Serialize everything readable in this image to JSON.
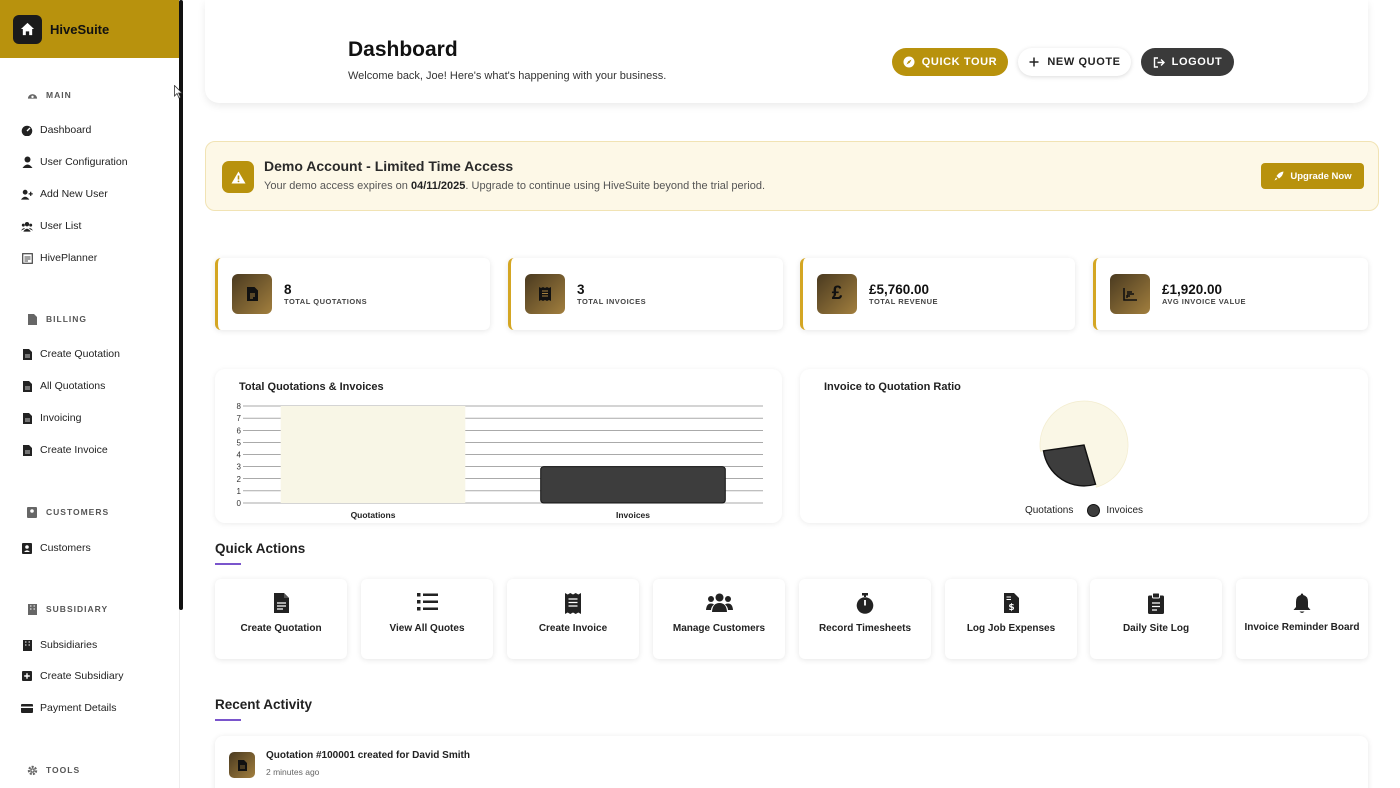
{
  "brand": {
    "name": "HiveSuite"
  },
  "sidebar": {
    "sections": {
      "main": "MAIN",
      "billing": "BILLING",
      "customers": "CUSTOMERS",
      "subsidiary": "SUBSIDIARY",
      "tools": "TOOLS"
    },
    "items": [
      {
        "label": "Dashboard",
        "icon": "gauge-icon"
      },
      {
        "label": "User Configuration",
        "icon": "user-icon"
      },
      {
        "label": "Add New User",
        "icon": "user-plus-icon"
      },
      {
        "label": "User List",
        "icon": "users-icon"
      },
      {
        "label": "HivePlanner",
        "icon": "planner-icon"
      },
      {
        "label": "Create Quotation",
        "icon": "file-icon"
      },
      {
        "label": "All Quotations",
        "icon": "file-icon"
      },
      {
        "label": "Invoicing",
        "icon": "file-icon"
      },
      {
        "label": "Create Invoice",
        "icon": "file-icon"
      },
      {
        "label": "Customers",
        "icon": "contact-icon"
      },
      {
        "label": "Subsidiaries",
        "icon": "building-icon"
      },
      {
        "label": "Create Subsidiary",
        "icon": "plus-square-icon"
      },
      {
        "label": "Payment Details",
        "icon": "card-icon"
      }
    ]
  },
  "header": {
    "title": "Dashboard",
    "subtitle": "Welcome back, Joe! Here's what's happening with your business.",
    "quick_tour": "QUICK TOUR",
    "new_quote": "NEW QUOTE",
    "logout": "LOGOUT"
  },
  "banner": {
    "title": "Demo Account - Limited Time Access",
    "text_before": "Your demo access expires on ",
    "date": "04/11/2025",
    "text_after": ". Upgrade to continue using HiveSuite beyond the trial period.",
    "upgrade": "Upgrade Now"
  },
  "stats": [
    {
      "value": "8",
      "label": "TOTAL QUOTATIONS"
    },
    {
      "value": "3",
      "label": "TOTAL INVOICES"
    },
    {
      "value": "£5,760.00",
      "label": "TOTAL REVENUE"
    },
    {
      "value": "£1,920.00",
      "label": "AVG INVOICE VALUE"
    }
  ],
  "charts": {
    "bar_title": "Total Quotations & Invoices",
    "pie_title": "Invoice to Quotation Ratio",
    "legend_quotations": "Quotations",
    "legend_invoices": "Invoices"
  },
  "chart_data": [
    {
      "type": "bar",
      "title": "Total Quotations & Invoices",
      "categories": [
        "Quotations",
        "Invoices"
      ],
      "values": [
        8,
        3
      ],
      "ylim": [
        0,
        8
      ],
      "yticks": [
        0,
        1,
        2,
        3,
        4,
        5,
        6,
        7,
        8
      ],
      "colors": [
        "#f8f6e6",
        "#3d3d3d"
      ]
    },
    {
      "type": "pie",
      "title": "Invoice to Quotation Ratio",
      "labels": [
        "Quotations",
        "Invoices"
      ],
      "values": [
        8,
        3
      ],
      "colors": [
        "#faf7e6",
        "#3d3d3d"
      ],
      "legend": "bottom"
    }
  ],
  "quick_actions": {
    "title": "Quick Actions",
    "items": [
      {
        "label": "Create Quotation",
        "icon": "file-icon"
      },
      {
        "label": "View All Quotes",
        "icon": "list-icon"
      },
      {
        "label": "Create Invoice",
        "icon": "receipt-icon"
      },
      {
        "label": "Manage Customers",
        "icon": "users-icon"
      },
      {
        "label": "Record Timesheets",
        "icon": "stopwatch-icon"
      },
      {
        "label": "Log Job Expenses",
        "icon": "invoice-dollar-icon"
      },
      {
        "label": "Daily Site Log",
        "icon": "clipboard-icon"
      },
      {
        "label": "Invoice Reminder Board",
        "icon": "bell-icon"
      }
    ]
  },
  "recent": {
    "title": "Recent Activity",
    "items": [
      {
        "title": "Quotation #100001 created for David Smith",
        "time": "2 minutes ago"
      }
    ]
  },
  "colors": {
    "accent": "#b8920d",
    "dark": "#3a3a3a",
    "underline": "#7a55cc"
  }
}
